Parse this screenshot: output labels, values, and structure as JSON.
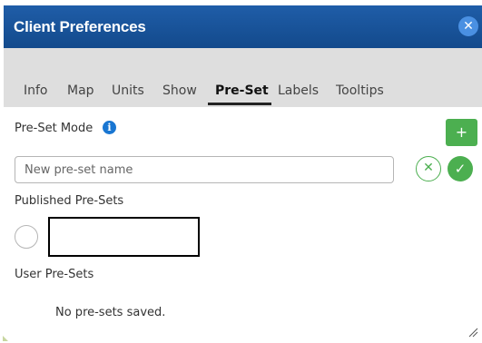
{
  "dialog": {
    "title": "Client Preferences",
    "close_icon_glyph": "✕"
  },
  "tabs": [
    {
      "label": "Info"
    },
    {
      "label": "Map"
    },
    {
      "label": "Units"
    },
    {
      "label": "Show"
    },
    {
      "label": "Pre-Set",
      "active": true
    },
    {
      "label": "Labels"
    },
    {
      "label": "Tooltips"
    }
  ],
  "preset": {
    "mode_label": "Pre-Set Mode",
    "info_icon_glyph": "i",
    "add_glyph": "+",
    "input_placeholder": "New pre-set name",
    "input_value": "",
    "cancel_glyph": "✕",
    "confirm_glyph": "✓",
    "published_label": "Published Pre-Sets",
    "user_label": "User Pre-Sets",
    "empty_message": "No pre-sets saved."
  },
  "colors": {
    "titlebar": "#1a56a0",
    "accent_green": "#4caf50",
    "info_blue": "#1976d2",
    "tabs_background": "#dedede"
  },
  "icons": [
    "close-icon",
    "info-icon",
    "plus-icon",
    "cancel-icon",
    "check-icon",
    "resize-handle-icon"
  ]
}
